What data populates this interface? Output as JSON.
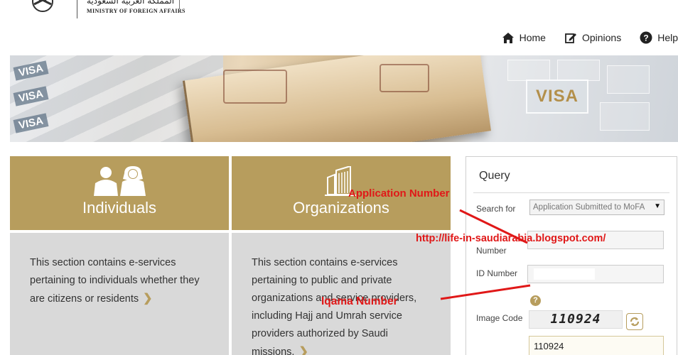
{
  "header": {
    "ministry_ar": "المملكة العربية السعودية",
    "ministry_en": "MINISTRY OF FOREIGN AFFAIRS"
  },
  "nav": {
    "home": "Home",
    "opinions": "Opinions",
    "help": "Help"
  },
  "banner": {
    "visa_label": "VISA",
    "side_visa": "VISA"
  },
  "cards": {
    "individuals": {
      "title": "Individuals",
      "text": "This section contains e-services pertaining to individuals whether they are citizens or residents"
    },
    "organizations": {
      "title": "Organizations",
      "text": "This section contains e-services pertaining to public and private organizations and service providers, including Hajj and Umrah service providers authorized by Saudi missions."
    }
  },
  "query": {
    "title": "Query",
    "search_for_label": "Search for",
    "search_for_value": "Application Submitted to MoFA",
    "application_label_line2": "Number",
    "id_label": "ID Number",
    "image_code_label": "Image Code",
    "captcha_text": "110924",
    "code_value": "110924",
    "help_symbol": "?"
  },
  "annotations": {
    "application_number": "Application Number",
    "iqama_number": "Iqama Number",
    "url": "http://life-in-saudiarabia.blogspot.com/"
  },
  "colors": {
    "gold": "#b79d5d",
    "card_body": "#d9d9d9",
    "annotation_red": "#e01818"
  }
}
